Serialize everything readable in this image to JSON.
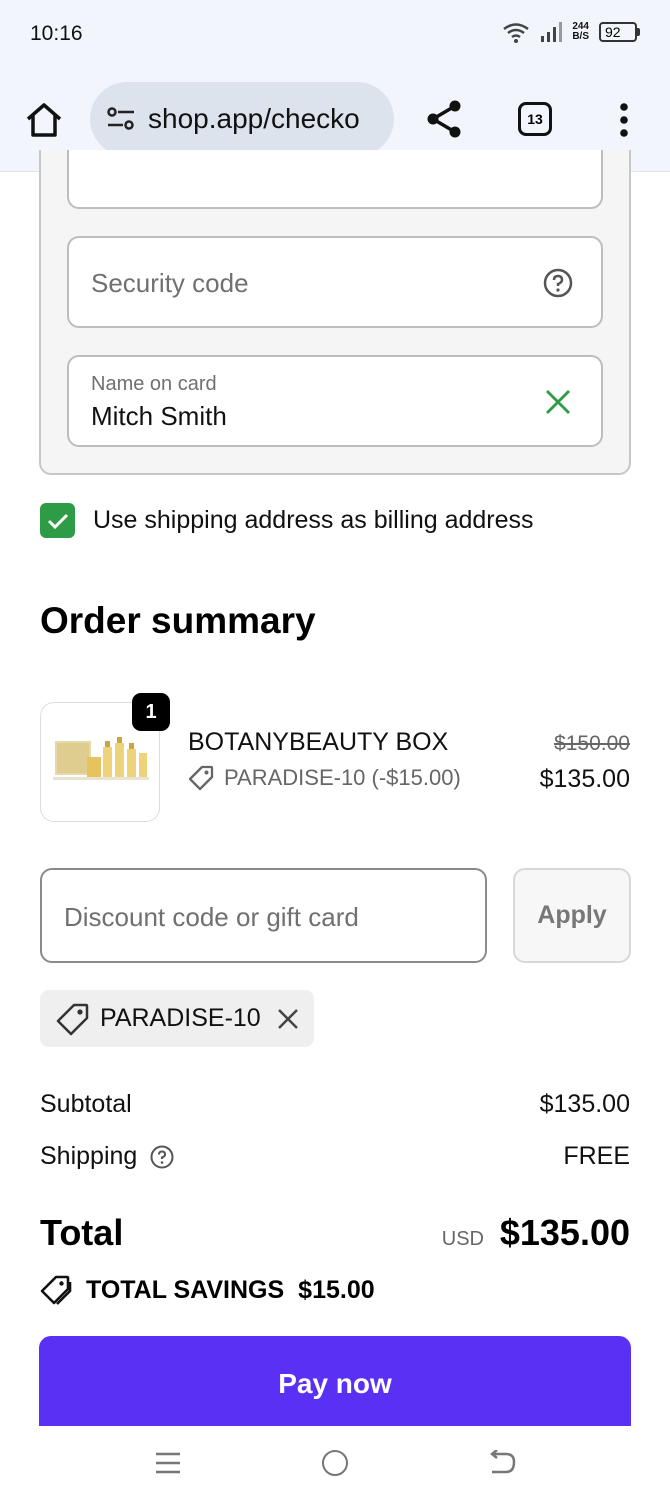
{
  "status_bar": {
    "time": "10:16",
    "speed_top": "244",
    "speed_bottom": "B/S",
    "battery": "92"
  },
  "browser": {
    "url": "shop.app/checko",
    "tab_count": "13"
  },
  "card_form": {
    "security_placeholder": "Security code",
    "name_label": "Name on card",
    "name_value": "Mitch Smith"
  },
  "billing": {
    "checked": true,
    "label": "Use shipping address as billing address"
  },
  "order_summary": {
    "title": "Order summary",
    "item": {
      "quantity": "1",
      "name": "BOTANYBEAUTY BOX",
      "discount": "PARADISE-10 (-$15.00)",
      "original_price": "$150.00",
      "price": "$135.00"
    },
    "discount_input_placeholder": "Discount code or gift card",
    "apply_label": "Apply",
    "applied_code": "PARADISE-10",
    "subtotal_label": "Subtotal",
    "subtotal_value": "$135.00",
    "shipping_label": "Shipping",
    "shipping_value": "FREE",
    "total_label": "Total",
    "total_currency": "USD",
    "total_value": "$135.00",
    "savings_label": "TOTAL SAVINGS",
    "savings_value": "$15.00",
    "pay_label": "Pay now"
  },
  "colors": {
    "pay_button": "#5a31f4",
    "checkbox": "#2e9c46",
    "valid_check": "#2e9c46"
  }
}
